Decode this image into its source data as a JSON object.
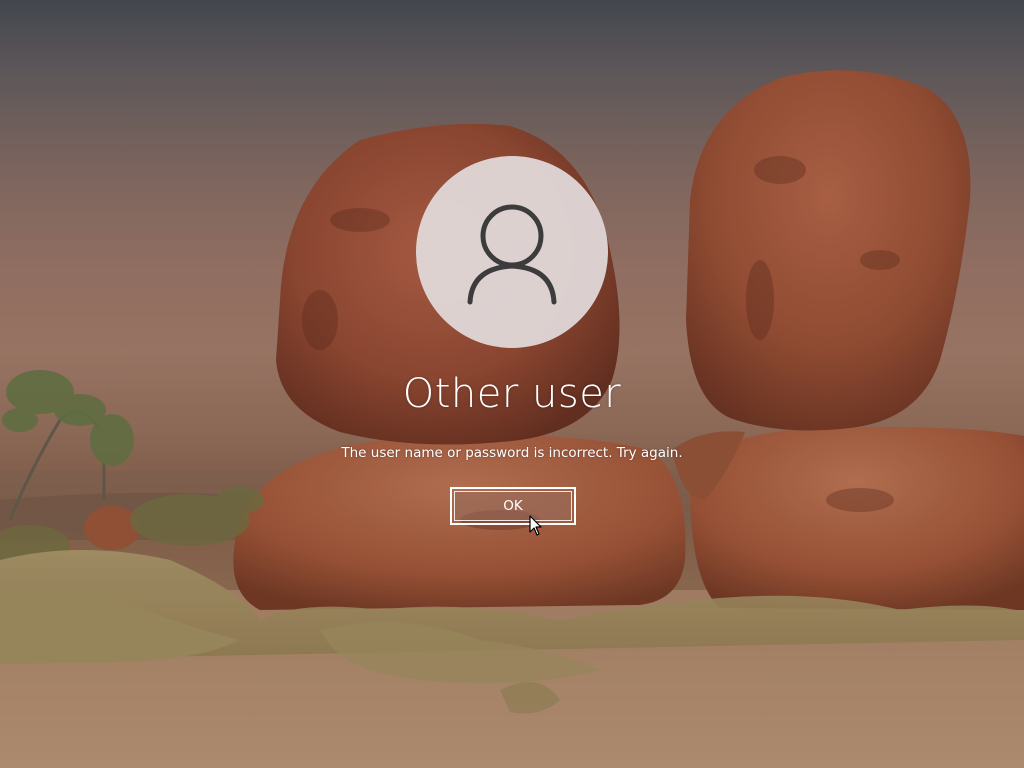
{
  "login": {
    "username": "Other user",
    "error_message": "The user name or password is incorrect. Try again.",
    "ok_label": "OK"
  },
  "icons": {
    "avatar": "user-silhouette-icon",
    "cursor": "mouse-pointer-icon"
  },
  "colors": {
    "text": "#ffffff",
    "avatar_bg": "#e2dcdc",
    "avatar_glyph": "#3c3c3c",
    "button_border": "#ffffff"
  }
}
